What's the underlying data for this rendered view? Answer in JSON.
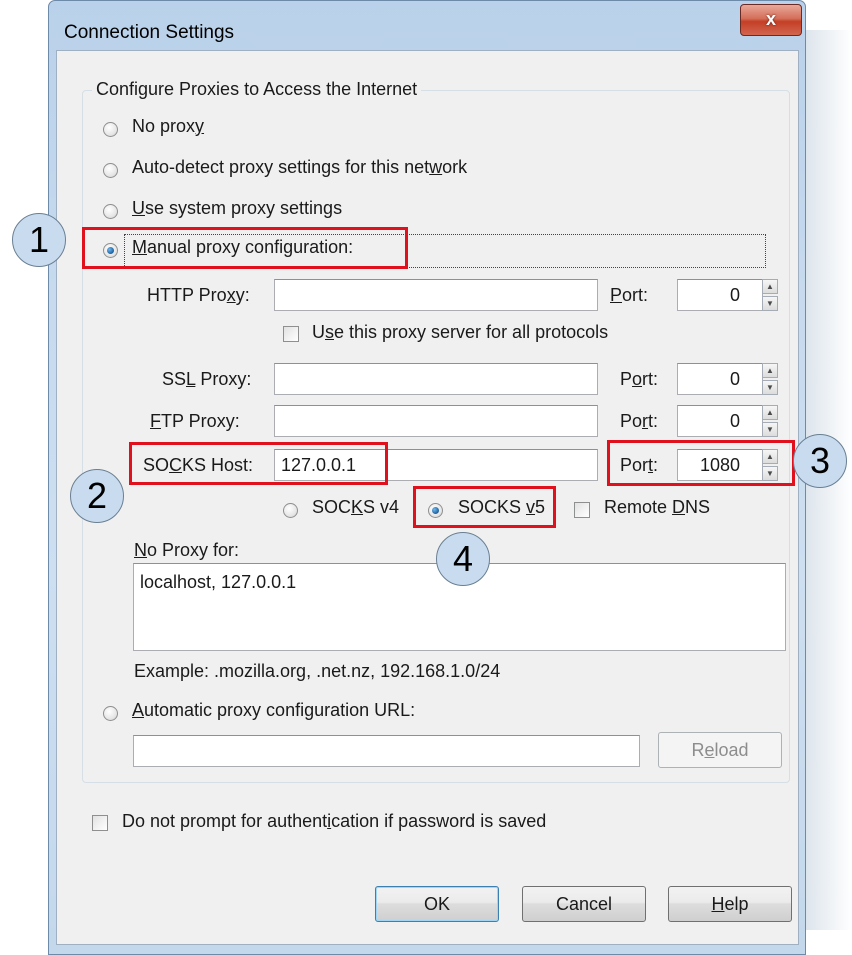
{
  "window": {
    "title": "Connection Settings",
    "close_label": "x"
  },
  "group": {
    "legend": "Configure Proxies to Access the Internet"
  },
  "radios": {
    "no_proxy": {
      "pre": "No prox",
      "u": "y",
      "post": "",
      "selected": false
    },
    "auto_detect": {
      "pre": "Auto-detect proxy settings for this net",
      "u": "w",
      "post": "ork",
      "selected": false
    },
    "system": {
      "pre": "",
      "u": "U",
      "post": "se system proxy settings",
      "selected": false
    },
    "manual": {
      "pre": "",
      "u": "M",
      "post": "anual proxy configuration:",
      "selected": true
    },
    "auto_url": {
      "pre": "",
      "u": "A",
      "post": "utomatic proxy configuration URL:",
      "selected": false
    }
  },
  "http": {
    "label_pre": "HTTP Pro",
    "label_u": "x",
    "label_post": "y:",
    "value": "",
    "port_label_pre": "",
    "port_label_u": "P",
    "port_label_post": "ort:",
    "port": "0"
  },
  "use_all": {
    "pre": "U",
    "u": "s",
    "post": "e this proxy server for all protocols",
    "checked": false
  },
  "ssl": {
    "label_pre": "SS",
    "label_u": "L",
    "label_post": " Proxy:",
    "value": "",
    "port_label_pre": "P",
    "port_label_u": "o",
    "port_label_post": "rt:",
    "port": "0"
  },
  "ftp": {
    "label_pre": "",
    "label_u": "F",
    "label_post": "TP Proxy:",
    "value": "",
    "port_label_pre": "Po",
    "port_label_u": "r",
    "port_label_post": "t:",
    "port": "0"
  },
  "socks": {
    "label_pre": "SO",
    "label_u": "C",
    "label_post": "KS Host:",
    "value": "127.0.0.1",
    "port_label_pre": "Por",
    "port_label_u": "t",
    "port_label_post": ":",
    "port": "1080",
    "v4": {
      "pre": "SOC",
      "u": "K",
      "post": "S v4",
      "selected": false
    },
    "v5": {
      "pre": "SOCKS ",
      "u": "v",
      "post": "5",
      "selected": true
    },
    "remote_dns": {
      "pre": "Remote ",
      "u": "D",
      "post": "NS",
      "checked": false
    }
  },
  "no_proxy_for": {
    "label_pre": "",
    "label_u": "N",
    "label_post": "o Proxy for:",
    "value": "localhost, 127.0.0.1",
    "example": "Example: .mozilla.org, .net.nz, 192.168.1.0/24"
  },
  "auto_url_value": "",
  "reload": {
    "pre": "R",
    "u": "e",
    "post": "load"
  },
  "no_auth": {
    "pre": "Do not prompt for authent",
    "u": "i",
    "post": "cation if password is saved",
    "checked": false
  },
  "buttons": {
    "ok": "OK",
    "cancel": "Cancel",
    "help": {
      "pre": "",
      "u": "H",
      "post": "elp"
    }
  },
  "callouts": [
    "1",
    "2",
    "3",
    "4"
  ],
  "colors": {
    "highlight": "#e0111c",
    "callout_fill": "#c9dcef",
    "close_button": "#c43f25"
  }
}
